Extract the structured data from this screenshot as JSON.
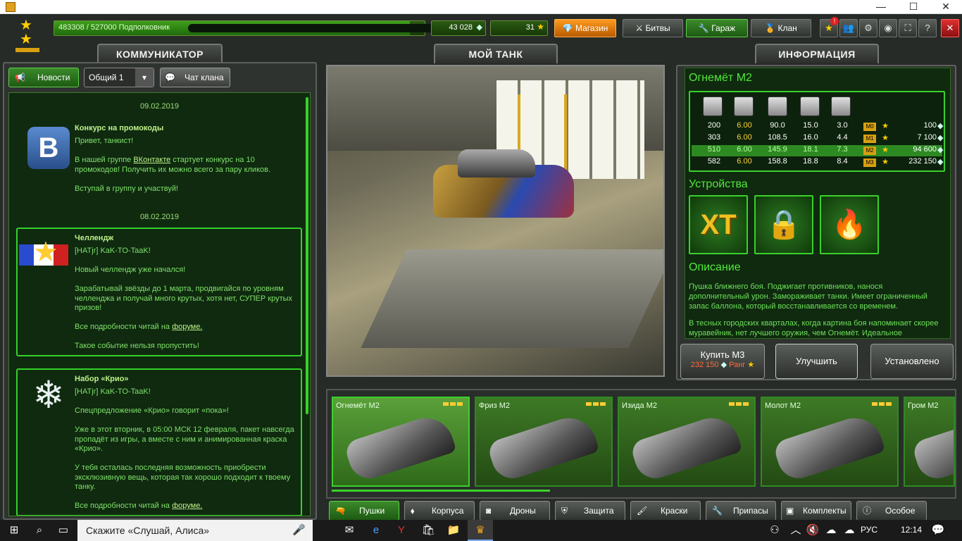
{
  "titlebar": {
    "min": "—",
    "max": "☐",
    "close": "✕"
  },
  "topbar": {
    "xp": "483308 / 527000  Подполковник",
    "crystals": "43 028",
    "stars": "31",
    "shop": "Магазин",
    "battles": "Битвы",
    "garage": "Гараж",
    "clan": "Клан"
  },
  "left": {
    "header": "КОММУНИКАТОР",
    "btn_news": "Новости",
    "channel": "Общий 1",
    "btn_clan_chat": "Чат клана",
    "date1": "09.02.2019",
    "n1": {
      "title": "Конкурс на промокоды",
      "text": "Привет, танкист!",
      "text2a": "В нашей группе ",
      "link": "ВКонтакте",
      "text2b": "  стартует конкурс на 10 промокодов! Получить их можно всего за пару кликов.",
      "text3": "Вступай в группу и участвуй!"
    },
    "date2": "08.02.2019",
    "n2": {
      "title": "Челлендж",
      "text": "[HATjr] KaK-TO-TaaK!",
      "text2": "Новый челлендж уже начался!",
      "text3": "Зарабатывай звёзды до 1 марта, продвигайся по уровням челленджа и получай много крутых, хотя нет, СУПЕР крутых призов!",
      "text4a": "Все подробности читай на  ",
      "link": "форуме.",
      "text5": "Такое событие нельзя пропустить!"
    },
    "n3": {
      "title": "Набор «Крио»",
      "text": "[HATjr] KaK-TO-TaaK!",
      "text2": "Спецпредложение «Крио» говорит «пока»!",
      "text3": "Уже в этот вторник, в 05:00 МСК 12 февраля, пакет навсегда пропадёт из игры, а вместе с ним и анимированная краска «Крио».",
      "text4": "У тебя осталась последняя возможность приобрести эксклюзивную вещь, которая так хорошо подходит к твоему танку.",
      "text5a": "Все подробности читай на ",
      "link": "форуме."
    }
  },
  "center": {
    "header": "МОЙ ТАНК"
  },
  "info": {
    "header": "ИНФОРМАЦИЯ",
    "item": "Огнемёт M2",
    "rows": [
      {
        "c1": "200",
        "c2": "6.00",
        "c3": "90.0",
        "c4": "15.0",
        "c5": "3.0",
        "m": "M0",
        "price": "100"
      },
      {
        "c1": "303",
        "c2": "6.00",
        "c3": "108.5",
        "c4": "16.0",
        "c5": "4.4",
        "m": "M1",
        "price": "7 100"
      },
      {
        "c1": "510",
        "c2": "6.00",
        "c3": "145.9",
        "c4": "18.1",
        "c5": "7.3",
        "m": "M2",
        "price": "94 600"
      },
      {
        "c1": "582",
        "c2": "6.00",
        "c3": "158.8",
        "c4": "18.8",
        "c5": "8.4",
        "m": "M3",
        "price": "232 150"
      }
    ],
    "devices_title": "Устройства",
    "dev1": "XT",
    "desc_title": "Описание",
    "desc1": "Пушка ближнего боя. Поджигает противников, нанося дополнительный урон. Замораживает танки. Имеет ограниченный запас баллона, который восстанавливается со временем.",
    "desc2": "В тесных городских кварталах, когда картина боя напоминает скорее муравейник, нет лучшего оружия, чем Огнемёт. Идеальное",
    "buy": "Купить М3",
    "buy_price": "232 150",
    "buy_rank": "Ранг",
    "upgrade": "Улучшить",
    "installed": "Установлено"
  },
  "carousel": {
    "items": [
      "Огнемёт M2",
      "Фриз M2",
      "Изида M2",
      "Молот M2",
      "Гром M2"
    ],
    "tabs": [
      "Пушки",
      "Корпуса",
      "Дроны",
      "Защита",
      "Краски",
      "Припасы",
      "Комплекты",
      "Особое"
    ]
  },
  "taskbar": {
    "search": "Скажите «Слушай, Алиса»",
    "lang": "РУС",
    "time": "12:14"
  }
}
